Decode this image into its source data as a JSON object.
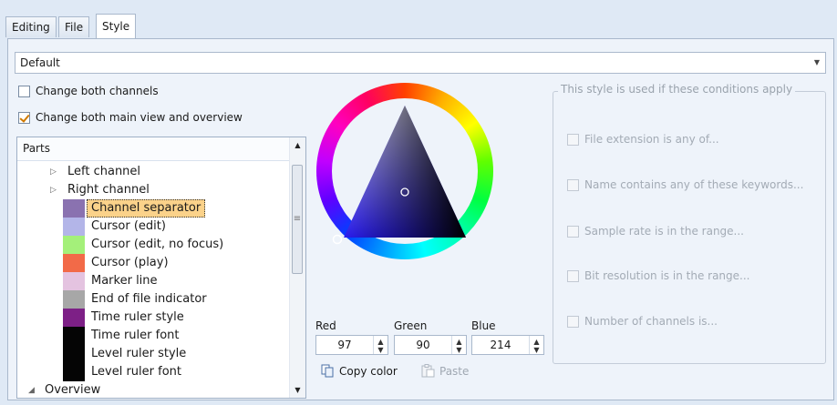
{
  "tabs": [
    {
      "label": "Editing",
      "active": false
    },
    {
      "label": "File",
      "active": false
    },
    {
      "label": "Style",
      "active": true
    }
  ],
  "style_select": {
    "value": "Default"
  },
  "options": {
    "change_both_channels": {
      "label": "Change both channels",
      "checked": false
    },
    "change_both_views": {
      "label": "Change both main view and overview",
      "checked": true
    }
  },
  "parts": {
    "header": "Parts",
    "items": [
      {
        "label": "Left channel",
        "expander": "▷",
        "color": null
      },
      {
        "label": "Right channel",
        "expander": "▷",
        "color": null
      },
      {
        "label": "Channel separator",
        "color": "#8a72b0",
        "selected": true
      },
      {
        "label": "Cursor (edit)",
        "color": "#b3b5e8"
      },
      {
        "label": "Cursor (edit, no focus)",
        "color": "#a4f07a"
      },
      {
        "label": "Cursor (play)",
        "color": "#f26a48"
      },
      {
        "label": "Marker line",
        "color": "#e4c3e0"
      },
      {
        "label": "End of file indicator",
        "color": "#a7a7a7"
      },
      {
        "label": "Time ruler style",
        "color": "#7d2086"
      },
      {
        "label": "Time ruler font",
        "color": "#050505"
      },
      {
        "label": "Level ruler style",
        "color": "#050505"
      },
      {
        "label": "Level ruler font",
        "color": "#050505"
      },
      {
        "label": "Overview",
        "expander": "◢",
        "color": null
      }
    ]
  },
  "color": {
    "red": {
      "label": "Red",
      "value": "97"
    },
    "green": {
      "label": "Green",
      "value": "90"
    },
    "blue": {
      "label": "Blue",
      "value": "214"
    },
    "copy_label": "Copy color",
    "paste_label": "Paste",
    "current_hex": "#615ad6"
  },
  "conditions": {
    "title": "This style is used if these conditions apply",
    "items": [
      {
        "label": "File extension is any of..."
      },
      {
        "label": "Name contains any of these keywords..."
      },
      {
        "label": "Sample rate is in the range..."
      },
      {
        "label": "Bit resolution is in the range..."
      },
      {
        "label": "Number of channels is..."
      }
    ]
  }
}
